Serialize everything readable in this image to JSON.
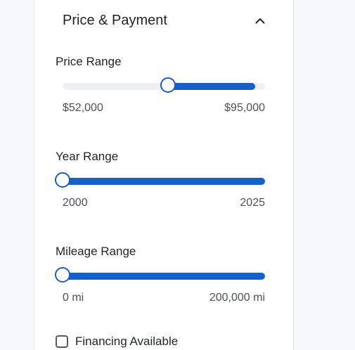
{
  "section": {
    "title": "Price & Payment",
    "expanded": true,
    "toggle_icon": "chevron-up-icon"
  },
  "sliders": [
    {
      "label": "Price Range",
      "min_label": "$52,000",
      "max_label": "$95,000",
      "low_fraction": 0.52,
      "high_fraction": 0.95
    },
    {
      "label": "Year Range",
      "min_label": "2000",
      "max_label": "2025",
      "low_fraction": 0.0,
      "high_fraction": 1.0
    },
    {
      "label": "Mileage Range",
      "min_label": "0 mi",
      "max_label": "200,000 mi",
      "low_fraction": 0.0,
      "high_fraction": 1.0
    }
  ],
  "financing": {
    "label": "Financing Available",
    "checked": false
  },
  "colors": {
    "accent": "#1462c9",
    "track": "#eef0f2"
  }
}
